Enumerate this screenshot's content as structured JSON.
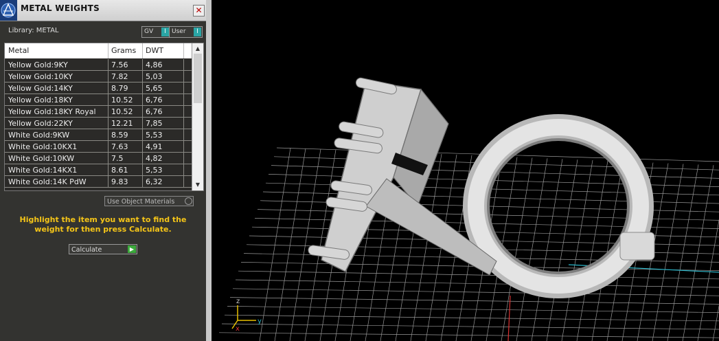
{
  "panel": {
    "title": "METAL WEIGHTS",
    "close_glyph": "✕",
    "library_label": "Library: METAL",
    "gv_label": "GV",
    "user_label": "User",
    "use_object_materials": "Use Object Materials",
    "instruction": "Highlight the item you want to find the weight for then press Calculate.",
    "calculate_label": "Calculate"
  },
  "table": {
    "columns": [
      "Metal",
      "Grams",
      "DWT"
    ],
    "rows": [
      [
        "Yellow Gold:9KY",
        "7.56",
        "4,86"
      ],
      [
        "Yellow Gold:10KY",
        "7.82",
        "5,03"
      ],
      [
        "Yellow Gold:14KY",
        "8.79",
        "5,65"
      ],
      [
        "Yellow Gold:18KY",
        "10.52",
        "6,76"
      ],
      [
        "Yellow Gold:18KY Royal",
        "10.52",
        "6,76"
      ],
      [
        "Yellow Gold:22KY",
        "12.21",
        "7,85"
      ],
      [
        "White Gold:9KW",
        "8.59",
        "5,53"
      ],
      [
        "White Gold:10KX1",
        "7.63",
        "4,91"
      ],
      [
        "White Gold:10KW",
        "7.5",
        "4,82"
      ],
      [
        "White Gold:14KX1",
        "8.61",
        "5,53"
      ],
      [
        "White Gold:14K PdW",
        "9.83",
        "6,32"
      ]
    ]
  },
  "viewport": {
    "axis_z": "z",
    "axis_y": "y",
    "axis_x": "x"
  },
  "icons": {
    "app": "app-logo-icon",
    "close": "close-icon",
    "toggle": "toggle-icon",
    "play": "play-icon",
    "scroll_up": "chevron-up-icon",
    "scroll_down": "chevron-down-icon"
  },
  "colors": {
    "panel_bg": "#333330",
    "accent_teal": "#2aa5a5",
    "instruction_yellow": "#f5c518",
    "calculate_green": "#3caa3c",
    "grid_line": "#a0a0a0"
  }
}
